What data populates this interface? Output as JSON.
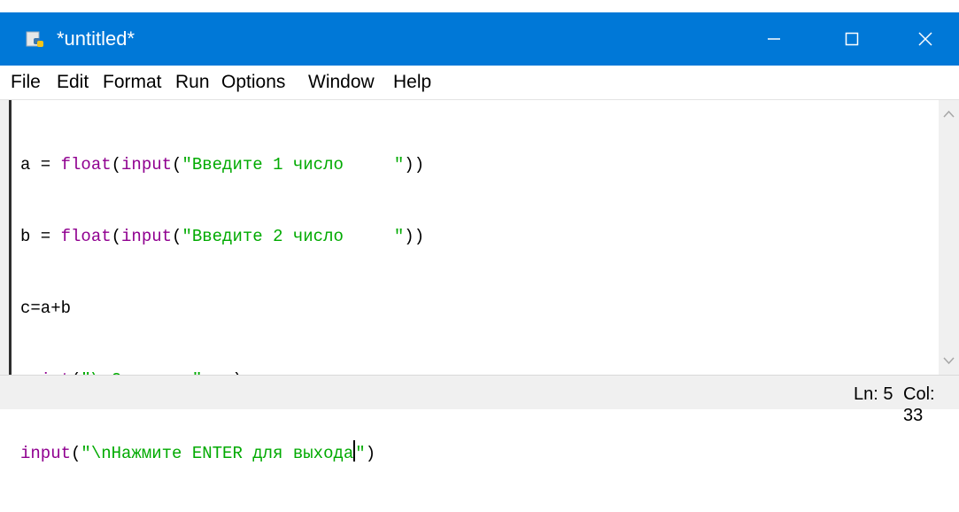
{
  "window": {
    "title": "*untitled*",
    "icon": "python-idle-icon"
  },
  "menubar": {
    "items": [
      {
        "label": "File"
      },
      {
        "label": "Edit"
      },
      {
        "label": "Format"
      },
      {
        "label": "Run"
      },
      {
        "label": "Options"
      },
      {
        "label": "Window"
      },
      {
        "label": "Help"
      }
    ]
  },
  "editor": {
    "lines": [
      {
        "a": "a = ",
        "kw": "float",
        "b": "(",
        "kw2": "input",
        "c": "(",
        "str": "\"Введите 1 число     \"",
        "d": "))"
      },
      {
        "a": "b = ",
        "kw": "float",
        "b": "(",
        "kw2": "input",
        "c": "(",
        "str": "\"Введите 2 число     \"",
        "d": "))"
      },
      {
        "plain": "c=a+b"
      },
      {
        "kw": "print",
        "b": "(",
        "str": "\"\\nСумма = \"",
        "d": ", c)"
      },
      {
        "kw": "input",
        "b": "(",
        "str": "\"\\nНажмите ENTER для выхода",
        "str_end": "\"",
        "d": ")"
      }
    ]
  },
  "status": {
    "line": "Ln: 5",
    "col": "Col: 33"
  },
  "colors": {
    "titlebar": "#0078d7",
    "keyword": "#900090",
    "string": "#00aa00"
  }
}
